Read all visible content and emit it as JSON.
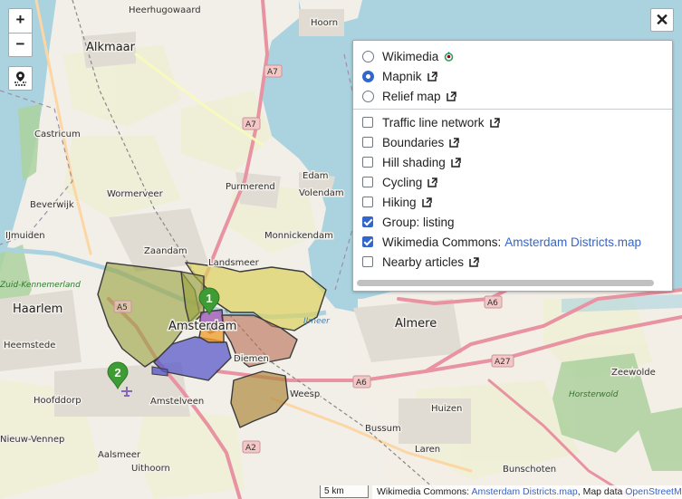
{
  "map": {
    "places": {
      "heerhugowaard": "Heerhugowaard",
      "hoorn": "Hoorn",
      "alkmaar": "Alkmaar",
      "castricum": "Castricum",
      "edam": "Edam",
      "volendam": "Volendam",
      "purmerend": "Purmerend",
      "wormerveer": "Wormerveer",
      "beverwijk": "Beverwijk",
      "ijmuiden": "IJmuiden",
      "zaandam": "Zaandam",
      "monnickendam": "Monnickendam",
      "landsmeer": "Landsmeer",
      "haarlem": "Haarlem",
      "heemstede": "Heemstede",
      "amsterdam": "Amsterdam",
      "diemen": "Diemen",
      "almere": "Almere",
      "weesp": "Weesp",
      "amstelveen": "Amstelveen",
      "hoofddorp": "Hoofddorp",
      "huizen": "Huizen",
      "zeewolde": "Zeewolde",
      "nieuw_vennep": "Nieuw-Vennep",
      "aalsmeer": "Aalsmeer",
      "bussum": "Bussum",
      "laren": "Laren",
      "uithoorn": "Uithoorn",
      "bunschoten": "Bunschoten",
      "ijmeer": "IJmeer",
      "horsterwold": "Horsterwold",
      "zuid_kennemerland": "Zuid-Kennemerland"
    },
    "roads": {
      "a7_top": "A7",
      "a7_mid": "A7",
      "a5": "A5",
      "a6_mid": "A6",
      "a6_low": "A6",
      "a27": "A27",
      "a2": "A2"
    },
    "markers": [
      "1",
      "2"
    ]
  },
  "controls": {
    "zoom_in": "+",
    "zoom_out": "−",
    "close": "✕"
  },
  "layers": {
    "base": [
      {
        "label": "Wikimedia",
        "selected": false
      },
      {
        "label": "Mapnik",
        "selected": true
      },
      {
        "label": "Relief map",
        "selected": false
      }
    ],
    "overlays": [
      {
        "label": "Traffic line network",
        "checked": false
      },
      {
        "label": "Boundaries",
        "checked": false
      },
      {
        "label": "Hill shading",
        "checked": false
      },
      {
        "label": "Cycling",
        "checked": false
      },
      {
        "label": "Hiking",
        "checked": false
      },
      {
        "label": "Group: listing",
        "checked": true
      },
      {
        "label": "Wikimedia Commons:",
        "link": "Amsterdam Districts.map",
        "checked": true
      },
      {
        "label": "Nearby articles",
        "checked": false
      }
    ]
  },
  "footer": {
    "scale": "5 km",
    "attribution_prefix": "Wikimedia Commons:",
    "attribution_link": "Amsterdam Districts.map",
    "attribution_mid": ", Map data ",
    "attribution_osm": "OpenStreetMap"
  },
  "colors": {
    "water": "#aad3df",
    "land": "#f2efe9",
    "marker": "#3f9c35",
    "accent": "#3366cc"
  }
}
